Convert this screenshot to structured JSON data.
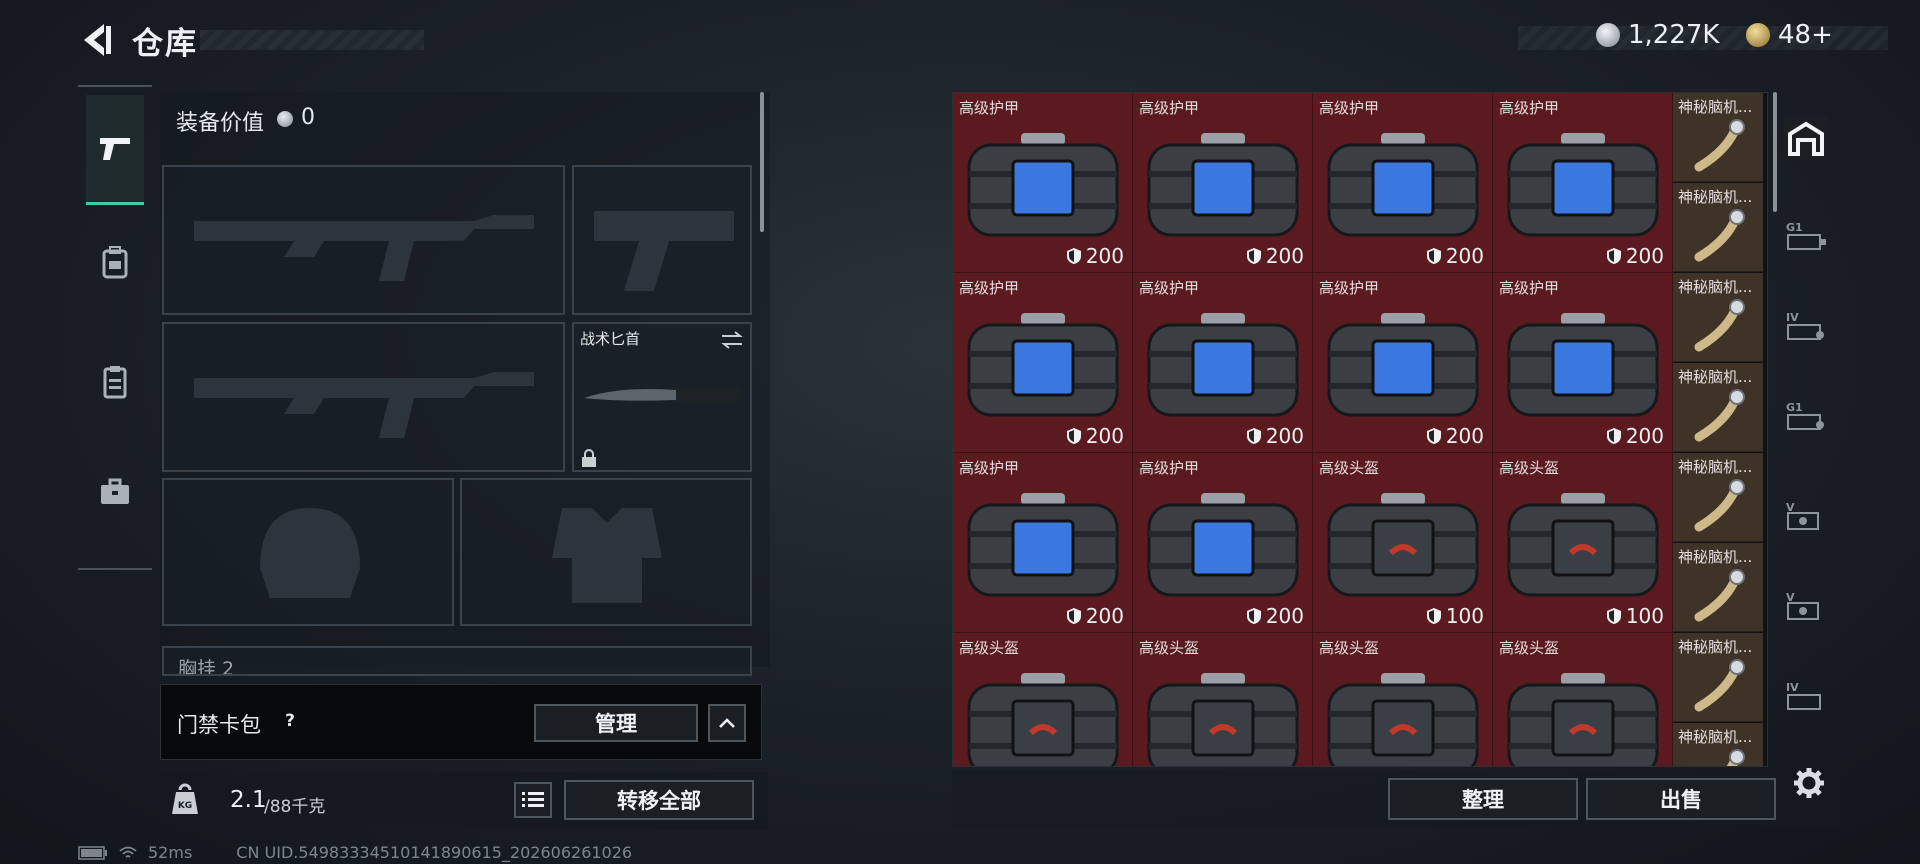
{
  "header": {
    "title": "仓库"
  },
  "currency": {
    "silver": "1,227K",
    "gold": "48+"
  },
  "equipment": {
    "value_label": "装备价值",
    "value": "0",
    "knife_slot_label": "战术匕首",
    "chest_label_partial": "胸挂 2"
  },
  "keycard": {
    "label": "门禁卡包",
    "help": "?",
    "manage_label": "管理"
  },
  "weight": {
    "current": "2.1",
    "max": "/88千克"
  },
  "bottom": {
    "transfer_all_label": "转移全部",
    "sort_label": "整理",
    "sell_label": "出售"
  },
  "status": {
    "ping": "52ms",
    "uid": "CN UID.54983334510141890615_202606261026"
  },
  "inventory": {
    "items": [
      {
        "name": "高级护甲",
        "value": "200",
        "type": "armor"
      },
      {
        "name": "高级护甲",
        "value": "200",
        "type": "armor"
      },
      {
        "name": "高级护甲",
        "value": "200",
        "type": "armor"
      },
      {
        "name": "高级护甲",
        "value": "200",
        "type": "armor"
      },
      {
        "name": "高级护甲",
        "value": "200",
        "type": "armor"
      },
      {
        "name": "高级护甲",
        "value": "200",
        "type": "armor"
      },
      {
        "name": "高级护甲",
        "value": "200",
        "type": "armor"
      },
      {
        "name": "高级护甲",
        "value": "200",
        "type": "armor"
      },
      {
        "name": "高级护甲",
        "value": "200",
        "type": "armor"
      },
      {
        "name": "高级护甲",
        "value": "200",
        "type": "armor"
      },
      {
        "name": "高级头盔",
        "value": "100",
        "type": "helmet"
      },
      {
        "name": "高级头盔",
        "value": "100",
        "type": "helmet"
      },
      {
        "name": "高级头盔",
        "value": "",
        "type": "helmet"
      },
      {
        "name": "高级头盔",
        "value": "",
        "type": "helmet"
      },
      {
        "name": "高级头盔",
        "value": "",
        "type": "helmet"
      },
      {
        "name": "高级头盔",
        "value": "",
        "type": "helmet"
      }
    ],
    "side_items": [
      {
        "name": "神秘脑机..."
      },
      {
        "name": "神秘脑机..."
      },
      {
        "name": "神秘脑机..."
      },
      {
        "name": "神秘脑机..."
      },
      {
        "name": "神秘脑机..."
      },
      {
        "name": "神秘脑机..."
      },
      {
        "name": "神秘脑机..."
      },
      {
        "name": "神秘脑机..."
      }
    ]
  },
  "right_tabs": [
    {
      "icon": "safehouse-icon"
    },
    {
      "icon": "stash-g1-icon",
      "label": "G1"
    },
    {
      "icon": "stash-iv-icon",
      "label": "IV"
    },
    {
      "icon": "stash-g1b-icon",
      "label": "G1"
    },
    {
      "icon": "stash-v-icon",
      "label": "V"
    },
    {
      "icon": "stash-v2-icon",
      "label": "V"
    },
    {
      "icon": "stash-iv2-icon",
      "label": "IV"
    }
  ],
  "colors": {
    "accent": "#3ec9a7",
    "armor_cell": "#5a1a1f",
    "side_cell": "#3f3328"
  }
}
